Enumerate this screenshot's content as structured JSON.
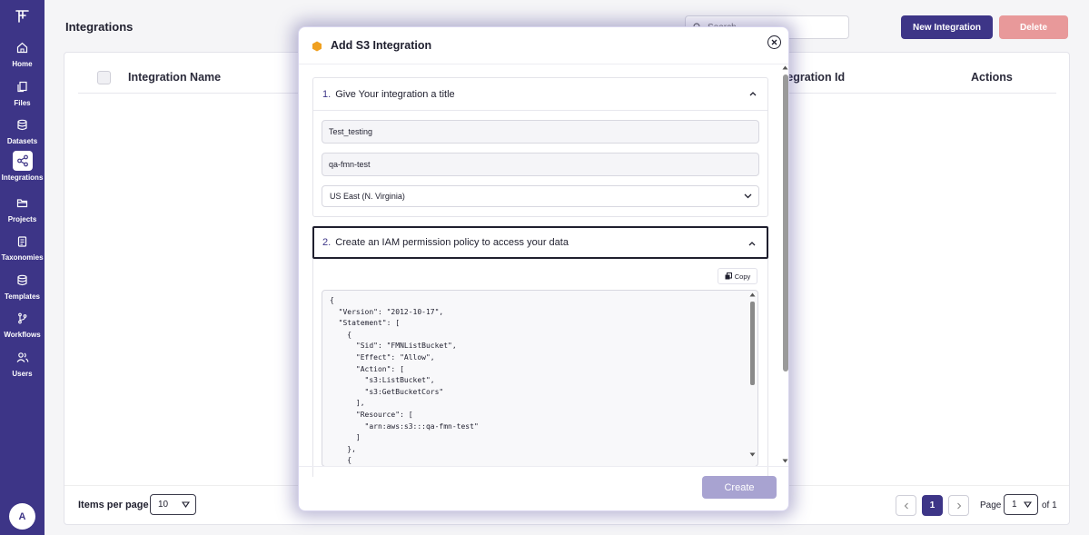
{
  "sidebar": {
    "items": [
      {
        "label": "Home",
        "icon": "home-icon"
      },
      {
        "label": "Files",
        "icon": "files-icon"
      },
      {
        "label": "Datasets",
        "icon": "database-icon"
      },
      {
        "label": "Integrations",
        "icon": "share-icon"
      },
      {
        "label": "Projects",
        "icon": "folder-icon"
      },
      {
        "label": "Taxonomies",
        "icon": "clipboard-icon"
      },
      {
        "label": "Templates",
        "icon": "database-icon"
      },
      {
        "label": "Workflows",
        "icon": "git-branch-icon"
      },
      {
        "label": "Users",
        "icon": "users-icon"
      }
    ],
    "active": "Integrations",
    "avatar": "A"
  },
  "header": {
    "title": "Integrations",
    "search_placeholder": "Search",
    "new_button": "New Integration",
    "delete_button": "Delete"
  },
  "table": {
    "columns": [
      "Integration Name",
      "Integration Id",
      "Actions"
    ]
  },
  "footer": {
    "items_per_page_label": "Items per page",
    "items_per_page_value": "10",
    "current_page": "1",
    "page_label": "Page",
    "page_select_value": "1",
    "of_label": "of 1"
  },
  "modal": {
    "title": "Add S3 Integration",
    "step1": {
      "number": "1.",
      "title": "Give Your integration a title",
      "name_value": "Test_testing",
      "bucket_value": "qa-fmn-test",
      "region_value": "US East (N. Virginia)"
    },
    "step2": {
      "number": "2.",
      "title": "Create an IAM permission policy to access your data",
      "copy_label": "Copy",
      "policy": "{\n  \"Version\": \"2012-10-17\",\n  \"Statement\": [\n    {\n      \"Sid\": \"FMNListBucket\",\n      \"Effect\": \"Allow\",\n      \"Action\": [\n        \"s3:ListBucket\",\n        \"s3:GetBucketCors\"\n      ],\n      \"Resource\": [\n        \"arn:aws:s3:::qa-fmn-test\"\n      ]\n    },\n    {"
    },
    "create_button": "Create"
  },
  "colors": {
    "brand": "#3d3587",
    "delete": "#e8999a",
    "create_disabled": "#a8a3d1",
    "s3_icon": "#f0a020"
  }
}
